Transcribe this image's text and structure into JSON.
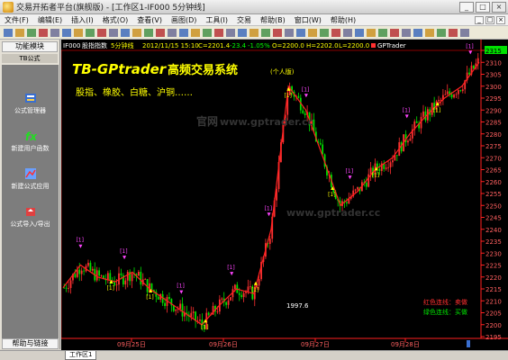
{
  "window": {
    "title": "交易开拓者平台(旗舰版) - [工作区1-IF000 5分钟线]",
    "minimize": "_",
    "maximize": "□",
    "close": "×"
  },
  "menu": {
    "items": [
      "文件(F)",
      "编辑(E)",
      "插入(I)",
      "格式(O)",
      "查看(V)",
      "画图(D)",
      "工具(I)",
      "交易",
      "帮助(B)",
      "窗口(W)",
      "帮助(H)"
    ],
    "right_buttons": [
      "_",
      "□",
      "×"
    ]
  },
  "left_panel": {
    "header": "功能模块",
    "section": "TB公式",
    "tools": [
      {
        "label": "公式管理器",
        "icon": "formula-manager-icon"
      },
      {
        "label": "新建用户函数",
        "icon": "new-function-icon"
      },
      {
        "label": "新建公式应用",
        "icon": "new-application-icon"
      },
      {
        "label": "公式导入/导出",
        "icon": "import-export-icon"
      }
    ],
    "footer": "帮助与链接"
  },
  "chart_header": {
    "symbol": "IF000",
    "name": "股指指数",
    "period": "5分钟线",
    "datetime": "2012/11/15 15:10",
    "close_label": "C=2201.4",
    "change": "-23.4",
    "change_pct": "-1.05%",
    "open_label": "O=2200.0",
    "high_label": "H=2202.0",
    "low_label": "L=2200.0",
    "indicator": "GPTrader"
  },
  "overlay": {
    "brand": "TB-GPtrader",
    "system_name": "高频交易系统",
    "edition": "(个人版)",
    "products": "股指、橡胶、白糖、沪铜……",
    "watermark_cn": "官网",
    "watermark_url": "www.gptrader.cc",
    "watermark_url2": "www.gptrader.cc",
    "annotation": "1997.6",
    "legend_red": "红色连线：卖做",
    "legend_green": "绿色连线：买做"
  },
  "chart_data": {
    "type": "candlestick",
    "x_labels": [
      "09月25日",
      "09月26日",
      "09月27日",
      "09月28日"
    ],
    "y_axis": {
      "min": 2195,
      "max": 2315,
      "ticks": [
        2195,
        2200,
        2205,
        2210,
        2215,
        2220,
        2225,
        2230,
        2235,
        2240,
        2245,
        2250,
        2255,
        2260,
        2265,
        2270,
        2275,
        2280,
        2285,
        2290,
        2295,
        2300,
        2305,
        2310,
        2315
      ],
      "highlight": 2315
    },
    "signal_label": "[1]",
    "trend_points": [
      2215.5,
      2225,
      2220,
      2218,
      2222,
      2215,
      2210,
      2205,
      2200,
      2208,
      2215,
      2213,
      2240,
      2300,
      2290,
      2270,
      2250,
      2256,
      2265,
      2270,
      2280,
      2288,
      2295,
      2300,
      2310
    ]
  },
  "statusbar": {
    "tab": "工作区1"
  },
  "colors": {
    "up": "#ff3030",
    "down": "#00e000",
    "axis": "#ff2020",
    "accent_yellow": "#ffff00",
    "signal_magenta": "#ff44ff"
  }
}
